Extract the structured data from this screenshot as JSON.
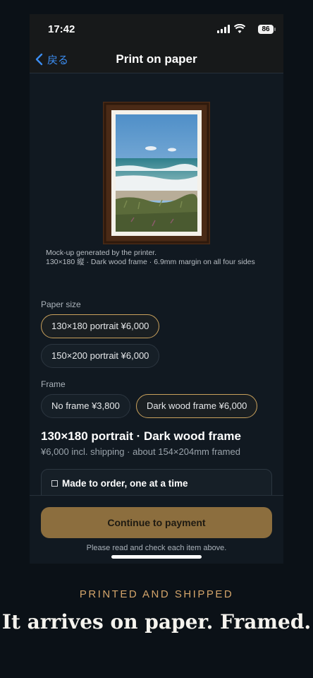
{
  "status_bar": {
    "time": "17:42",
    "battery": "86"
  },
  "nav": {
    "back_label": "戻る",
    "title": "Print on paper"
  },
  "preview": {
    "caption_line1": "Mock-up generated by the printer.",
    "caption_line2": "130×180 縦 · Dark wood frame · 6.9mm margin on all four sides"
  },
  "paper_size": {
    "label": "Paper size",
    "options": [
      {
        "label": "130×180 portrait ¥6,000",
        "selected": true
      },
      {
        "label": "150×200 portrait ¥6,000",
        "selected": false
      }
    ]
  },
  "frame": {
    "label": "Frame",
    "options": [
      {
        "label": "No frame ¥3,800",
        "selected": false
      },
      {
        "label": "Dark wood frame ¥6,000",
        "selected": true
      }
    ]
  },
  "summary": {
    "title": "130×180 portrait · Dark wood frame",
    "subtitle": "¥6,000 incl. shipping · about 154×204mm framed"
  },
  "checklist": {
    "first_item": "Made to order, one at a time"
  },
  "footer": {
    "button_label": "Continue to payment",
    "note": "Please read and check each item above."
  },
  "promo": {
    "kicker": "PRINTED AND SHIPPED",
    "title": "It arrives on paper. Framed."
  },
  "colors": {
    "accent": "#c9a15c",
    "button": "#8c6e3e",
    "link": "#3b8cf0",
    "frame_wood": "#4a2a16"
  }
}
